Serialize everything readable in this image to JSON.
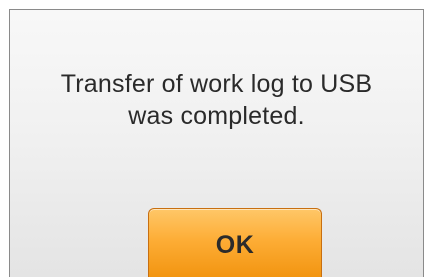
{
  "dialog": {
    "message_line1": "Transfer of work log to USB",
    "message_line2": "was completed.",
    "ok_label": "OK"
  },
  "colors": {
    "dialog_background": "#f1f1f1",
    "dialog_border": "#8a8a8a",
    "button_accent": "#fdad36",
    "text": "#2a2a2a"
  }
}
